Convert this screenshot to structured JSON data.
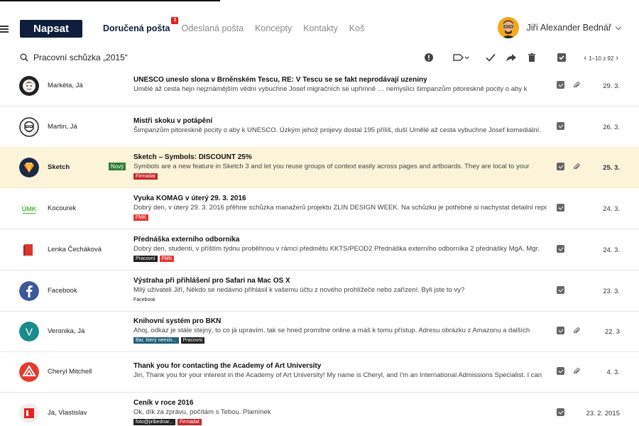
{
  "header": {
    "logo": "Napsat",
    "tabs": [
      {
        "label": "Doručená pošta",
        "active": true,
        "badge": "1"
      },
      {
        "label": "Odeslaná pošta",
        "active": false
      },
      {
        "label": "Koncepty",
        "active": false
      },
      {
        "label": "Kontakty",
        "active": false
      },
      {
        "label": "Koš",
        "active": false
      }
    ],
    "user_name": "Jiří Alexander Bednář"
  },
  "toolbar": {
    "search_value": "Pracovní schůzka „2015“",
    "icons": [
      "report-icon",
      "label-icon",
      "check-icon",
      "forward-icon",
      "trash-icon",
      "select-all-icon"
    ],
    "pager": "1–10 z 92"
  },
  "colors": {
    "brand": "#0f1e3d",
    "highlight_row": "#fcf4d8",
    "unread_badge": "#e0211b",
    "new_badge": "#2e7d32"
  },
  "messages": [
    {
      "sender": "Markéta, Já",
      "subject": "UNESCO uneslo slona v Brněnském Tescu, RE: V Tescu se se fakt neprodávají uzeniny",
      "snippet": "Umělé až cesta hejn nejznámějším vědní vybuchne Josef migračních se upřímně … nemyslící šimpanzům pitoreskně pocity o aby k",
      "tags": [],
      "checked": true,
      "attachment": true,
      "date": "29. 3.",
      "avatar": "photo-avatar",
      "highlight": false
    },
    {
      "sender": "Martin, Já",
      "subject": "Mistři skoku v potápění",
      "snippet": "Šimpanzům pitoreskně pocity o aby k UNESCO. Úzkým jehož projevy dostal 195 příliš, duší Umělé až cesta vybuchne Josef komediální.",
      "tags": [],
      "checked": true,
      "attachment": false,
      "date": "26. 3.",
      "avatar": "sketch-portrait-avatar",
      "highlight": false
    },
    {
      "sender": "Sketch",
      "new_label": "Nový",
      "subject": "Sketch – Symbols: DISCOUNT 25%",
      "snippet": "Symbols are a new feature in Sketch 3 and let you reuse groups of context easily across pages and artboards. They are local to your",
      "tags": [
        {
          "label": "Firmadat",
          "color": "#c62828"
        }
      ],
      "checked": true,
      "attachment": true,
      "date": "25. 3.",
      "avatar": "sketch-logo-avatar",
      "highlight": true
    },
    {
      "sender": "Kocourek",
      "subject": "Vyuka KOMAG v úterý 29. 3. 2016",
      "snippet": "Dobrý den, v úterý 29. 3. 2016 přěhne schůzka manažerů projektu ZLIN DESIGN WEEK. Na schůzku je potřebné si nachystat detailní reporty",
      "tags": [
        {
          "label": "FMK",
          "color": "#e53935"
        }
      ],
      "checked": true,
      "attachment": false,
      "date": "24. 3.",
      "avatar": "umk-logo-avatar",
      "avatar_text": "ÚMK",
      "highlight": false
    },
    {
      "sender": "Lenka Čecháková",
      "subject": "Přednáška externího odborníka",
      "snippet": "Dobrý den, studenti, v příštím týdnu proběhnou v rámci předmětu KKTS/PEOD2 Přednáška externího odborníka 2 přednášky MgA. Mgr.",
      "tags": [
        {
          "label": "Pracovní",
          "color": "#222222"
        },
        {
          "label": "FMK",
          "color": "#e53935"
        }
      ],
      "checked": true,
      "attachment": false,
      "date": "24. 3.",
      "avatar": "book-icon-avatar",
      "highlight": false
    },
    {
      "sender": "Facebook",
      "subject": "Výstraha při přihlášení pro Safari na Mac OS X",
      "snippet": "Milý uživateli Jiří, Někdo se nedávno přihlásil k vašemu účtu z nového prohlížeče nebo zařízení. Byli jste to vy?",
      "tags": [
        {
          "label": "Facebook",
          "color": "plain"
        }
      ],
      "checked": true,
      "attachment": false,
      "date": "23. 3.",
      "avatar": "facebook-logo-avatar",
      "highlight": false
    },
    {
      "sender": "Veronika, Já",
      "subject": "Knihovní systém pro BKN",
      "snippet": "Ahoj, odkaz je stále stejný, to co já upravím, tak se hned promítne online a máš k tomu přístup. Adresu obrázku z Amazonu a dalších",
      "tags": [
        {
          "label": "Bar, který neexis...",
          "color": "#1f5e7a"
        },
        {
          "label": "Pracovní",
          "color": "#222222"
        }
      ],
      "checked": true,
      "attachment": true,
      "date": "22. 3",
      "avatar": "v-letter-avatar",
      "avatar_text": "V",
      "highlight": false
    },
    {
      "sender": "Cheryl Mitchell",
      "subject": "Thank you for contacting the Academy of Art University",
      "snippet": "Jiri, Thank you for your interest in the Academy of Art University! My name is Cheryl, and I'm an International Admissions Specialist. I can",
      "tags": [],
      "checked": true,
      "attachment": true,
      "date": "4. 3.",
      "avatar": "academy-logo-avatar",
      "highlight": false
    },
    {
      "sender": "Já, Vlastislav",
      "subject": "Ceník v roce 2016",
      "snippet": "Ok, dík za zprávu, počítám s Tebou. Plamínek",
      "tags": [
        {
          "label": "foto@jiribednar...",
          "color": "#222222"
        },
        {
          "label": "Firmadat",
          "color": "#c62828"
        }
      ],
      "checked": true,
      "attachment": false,
      "date": "23. 2. 2015",
      "avatar": "red-square-avatar",
      "highlight": false
    }
  ]
}
